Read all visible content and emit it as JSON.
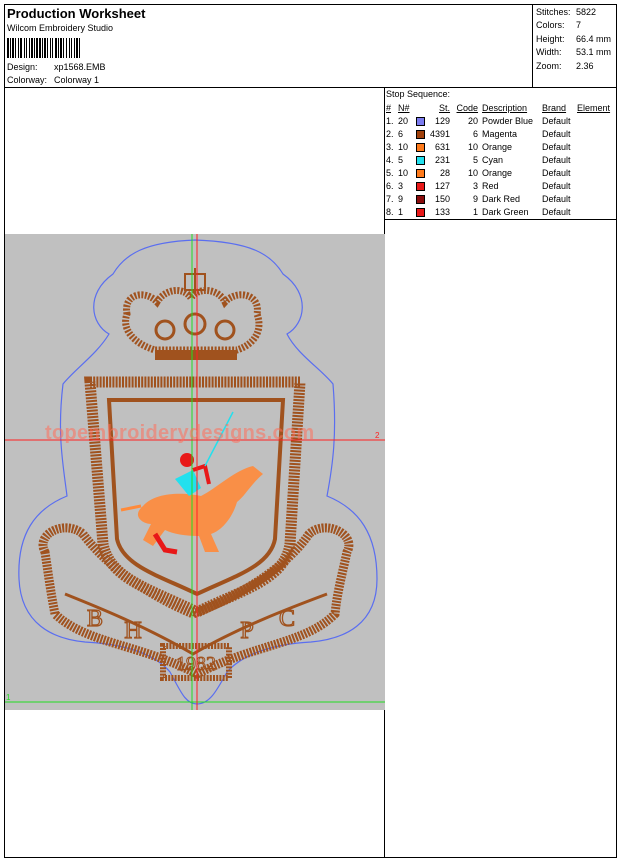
{
  "header": {
    "title": "Production Worksheet",
    "software": "Wilcom Embroidery Studio",
    "design_label": "Design:",
    "design_value": "xp1568.EMB",
    "colorway_label": "Colorway:",
    "colorway_value": "Colorway 1"
  },
  "stats": [
    {
      "label": "Stitches:",
      "value": "5822"
    },
    {
      "label": "Colors:",
      "value": "7"
    },
    {
      "label": "Height:",
      "value": "66.4 mm"
    },
    {
      "label": "Width:",
      "value": "53.1 mm"
    },
    {
      "label": "Zoom:",
      "value": "2.36"
    }
  ],
  "stop_sequence": {
    "label": "Stop Sequence:",
    "columns": [
      "#",
      "N#",
      "St.",
      "Code",
      "Description",
      "Brand",
      "Element"
    ],
    "rows": [
      {
        "num": "1.",
        "n": "20",
        "color": "#7b7bef",
        "st": "129",
        "code": "20",
        "desc": "Powder Blue",
        "brand": "Default"
      },
      {
        "num": "2.",
        "n": "6",
        "color": "#a0400a",
        "st": "4391",
        "code": "6",
        "desc": "Magenta",
        "brand": "Default"
      },
      {
        "num": "3.",
        "n": "10",
        "color": "#ff7a1a",
        "st": "631",
        "code": "10",
        "desc": "Orange",
        "brand": "Default"
      },
      {
        "num": "4.",
        "n": "5",
        "color": "#22e0ee",
        "st": "231",
        "code": "5",
        "desc": "Cyan",
        "brand": "Default"
      },
      {
        "num": "5.",
        "n": "10",
        "color": "#ff7a1a",
        "st": "28",
        "code": "10",
        "desc": "Orange",
        "brand": "Default"
      },
      {
        "num": "6.",
        "n": "3",
        "color": "#e81818",
        "st": "127",
        "code": "3",
        "desc": "Red",
        "brand": "Default"
      },
      {
        "num": "7.",
        "n": "9",
        "color": "#8a0c0c",
        "st": "150",
        "code": "9",
        "desc": "Dark Red",
        "brand": "Default"
      },
      {
        "num": "8.",
        "n": "1",
        "color": "#e81818",
        "st": "133",
        "code": "1",
        "desc": "Dark Green",
        "brand": "Default"
      }
    ]
  },
  "design": {
    "watermark": "topembroiderydesigns.com",
    "letters": [
      "B",
      "H",
      "P",
      "C"
    ],
    "year": "1982",
    "guide_label_right": "2",
    "guide_label_left": "1",
    "colors": {
      "background": "#c0c0c0",
      "thread_main": "#a0521e",
      "outline": "#5a6ef0",
      "horse": "#ff8a3a",
      "rider_cyan": "#22e0ee",
      "rider_red": "#e81818",
      "guide_red": "#ff2020",
      "guide_green": "#22dd22"
    }
  }
}
